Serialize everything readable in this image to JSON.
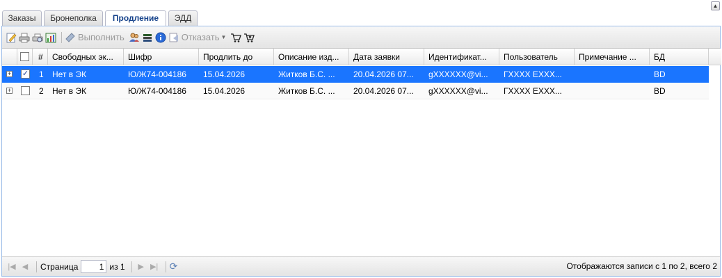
{
  "tabs": [
    {
      "label": "Заказы",
      "active": false
    },
    {
      "label": "Бронеполка",
      "active": false
    },
    {
      "label": "Продление",
      "active": true
    },
    {
      "label": "ЭДД",
      "active": false
    }
  ],
  "toolbar": {
    "icons": [
      "edit-icon",
      "print-icon",
      "print-preview-icon",
      "excel-icon"
    ],
    "execute_label": "Выполнить",
    "extra_icons": [
      "users-icon",
      "books-icon",
      "info-icon"
    ],
    "reject_label": "Отказать",
    "cart_icons": [
      "cart-icon",
      "cart-remove-icon"
    ]
  },
  "grid": {
    "columns": [
      "#",
      "Свободных эк...",
      "Шифр",
      "Продлить до",
      "Описание изд...",
      "Дата заявки",
      "Идентификат...",
      "Пользователь",
      "Примечание ...",
      "БД"
    ],
    "rows": [
      {
        "selected": true,
        "checked": true,
        "cells": [
          "1",
          "Нет в ЭК",
          "Ю/Ж74-004186",
          "15.04.2026",
          "Житков Б.С. ...",
          "20.04.2026 07...",
          "gXXXXXX@vi...",
          "ГXXXX EXXX...",
          "",
          "BD"
        ]
      },
      {
        "selected": false,
        "checked": false,
        "cells": [
          "2",
          "Нет в ЭК",
          "Ю/Ж74-004186",
          "15.04.2026",
          "Житков Б.С. ...",
          "20.04.2026 07...",
          "gXXXXXX@vi...",
          "ГXXXX EXXX...",
          "",
          "BD"
        ]
      }
    ]
  },
  "pager": {
    "page_label": "Страница",
    "page_value": "1",
    "of_label": "из 1",
    "info": "Отображаются записи с 1 по 2, всего 2"
  },
  "colors": {
    "selected_row": "#1a75ff",
    "active_tab_text": "#15428b",
    "panel_border": "#99bbe8"
  }
}
